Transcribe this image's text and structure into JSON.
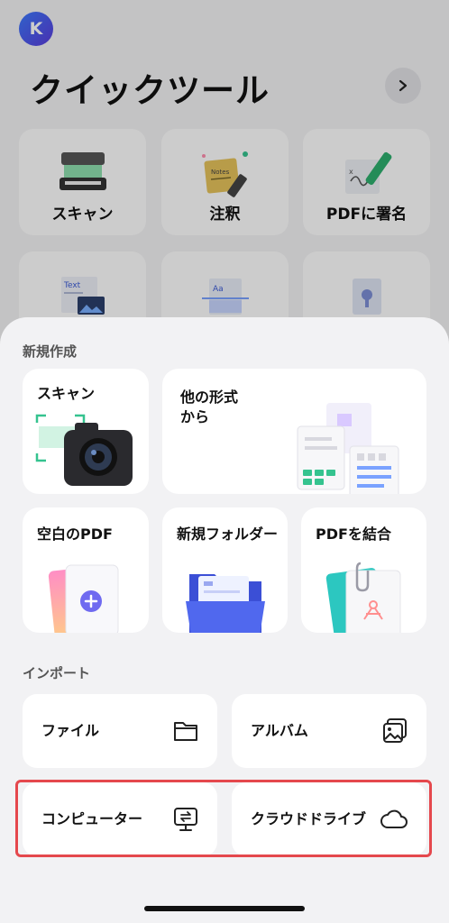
{
  "background": {
    "avatar_letter": "K",
    "title": "クイックツール",
    "quick_tools": [
      {
        "label": "スキャン",
        "icon": "scanner-icon"
      },
      {
        "label": "注釈",
        "icon": "notes-icon"
      },
      {
        "label": "PDFに署名",
        "icon": "signature-icon"
      },
      {
        "label": "",
        "icon": "text-image-icon"
      },
      {
        "label": "",
        "icon": "ocr-icon"
      },
      {
        "label": "",
        "icon": "image-file-icon"
      }
    ]
  },
  "sheet": {
    "create_section": "新規作成",
    "create_tiles": {
      "scan": "スキャン",
      "other_format_line1": "他の形式",
      "other_format_line2": "から",
      "blank_pdf": "空白のPDF",
      "new_folder": "新規フォルダー",
      "merge_pdf": "PDFを結合"
    },
    "import_section": "インポート",
    "import_items": [
      {
        "label": "ファイル",
        "icon": "folder-icon"
      },
      {
        "label": "アルバム",
        "icon": "photo-album-icon"
      },
      {
        "label": "コンピューター",
        "icon": "computer-transfer-icon"
      },
      {
        "label": "クラウドドライブ",
        "icon": "cloud-icon"
      }
    ]
  },
  "colors": {
    "highlight": "#e5484d",
    "accent_green": "#35c38f",
    "accent_blue": "#4a6cf7"
  }
}
